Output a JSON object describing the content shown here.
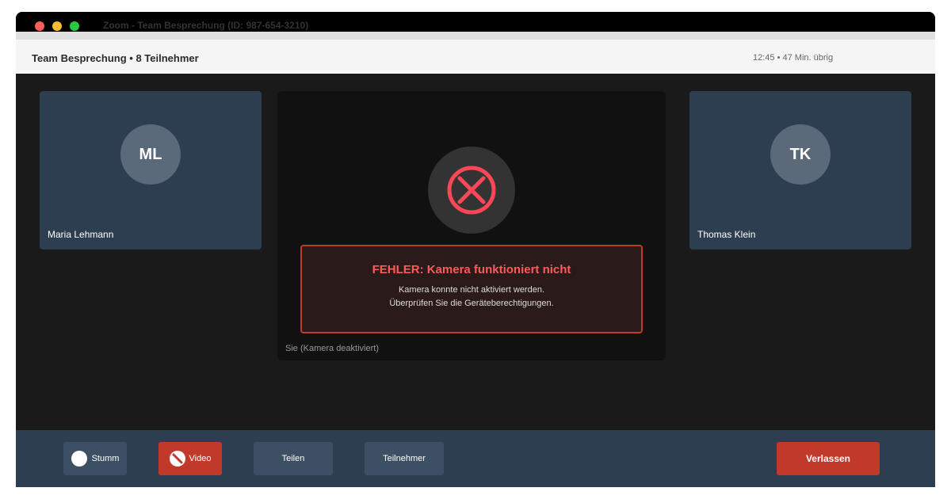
{
  "window": {
    "title": "Zoom - Team Besprechung (ID: 987-654-3210)"
  },
  "header": {
    "meeting_title": "Team Besprechung • 8 Teilnehmer",
    "time_info": "12:45 • 47 Min. übrig"
  },
  "participants": [
    {
      "initials": "ML",
      "name": "Maria Lehmann"
    },
    {
      "initials": "TK",
      "name": "Thomas Klein"
    }
  ],
  "self_view": {
    "label": "Sie (Kamera deaktiviert)",
    "icon": "camera-error-icon"
  },
  "error": {
    "title": "FEHLER: Kamera funktioniert nicht",
    "line1": "Kamera konnte nicht aktiviert werden.",
    "line2": "Überprüfen Sie die Geräteberechtigungen."
  },
  "toolbar": {
    "mute_label": "Stumm",
    "video_label": "Video",
    "share_label": "Teilen",
    "participants_label": "Teilnehmer",
    "leave_label": "Verlassen"
  },
  "colors": {
    "error_accent": "#ff4757",
    "danger_button": "#c0392b",
    "panel": "#2d3e50"
  }
}
